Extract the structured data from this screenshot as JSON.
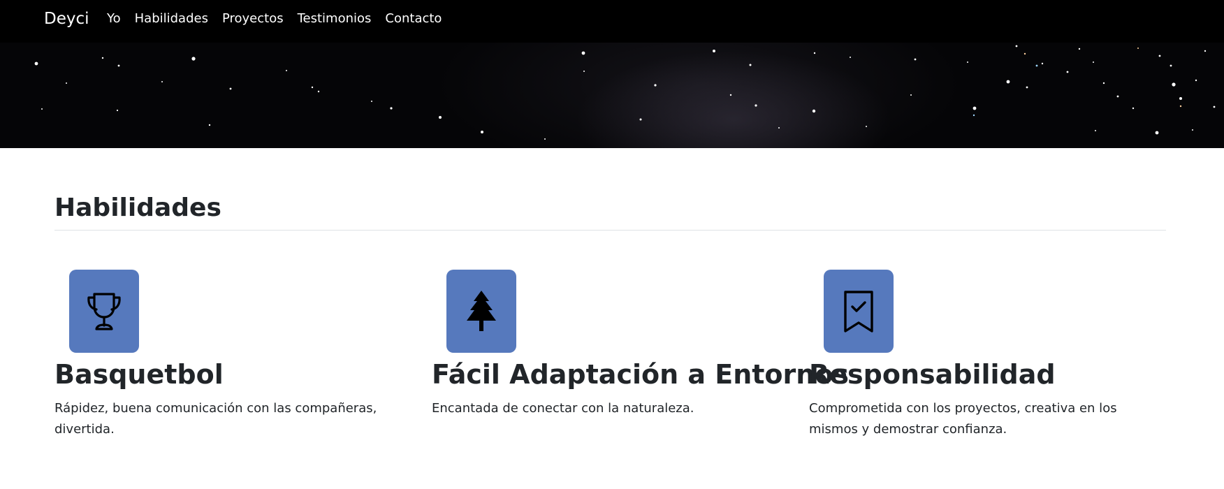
{
  "navbar": {
    "brand": "Deyci",
    "links": [
      "Yo",
      "Habilidades",
      "Proyectos",
      "Testimonios",
      "Contacto"
    ]
  },
  "section": {
    "title": "Habilidades"
  },
  "features": [
    {
      "icon": "trophy-icon",
      "title": "Basquetbol",
      "text": "Rápidez, buena comunicación con las compañeras, divertida."
    },
    {
      "icon": "tree-icon",
      "title": "Fácil Adaptación a Entornos",
      "text": "Encantada de conectar con la naturaleza."
    },
    {
      "icon": "bookmark-check-icon",
      "title": "Responsabilidad",
      "text": "Comprometida con los proyectos, creativa en los mismos y demostrar confianza."
    }
  ],
  "colors": {
    "navbar_bg": "#000000",
    "icon_box_bg": "#5679bd",
    "text": "#212529",
    "divider": "#dee2e6"
  }
}
